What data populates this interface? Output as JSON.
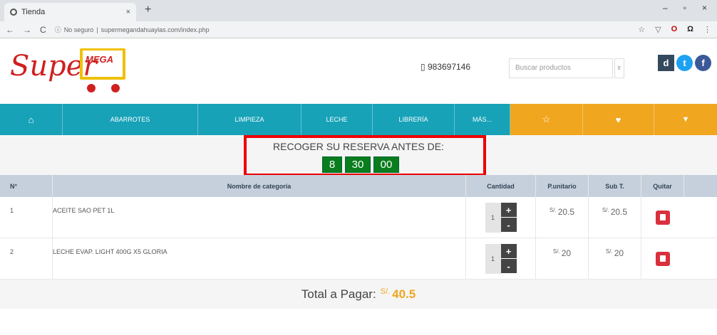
{
  "browser": {
    "tab_title": "Tienda",
    "tab_close": "×",
    "new_tab": "+",
    "url_security": "No seguro",
    "url": "supermegandahuaylas.com/index.php",
    "window_controls": [
      "–",
      "▫",
      "×"
    ]
  },
  "header": {
    "logo_super": "Super",
    "logo_mega": "MEGA",
    "phone": "983697146",
    "search_placeholder": "Buscar productos",
    "search_button": "ir",
    "social": [
      "d",
      "t",
      "f"
    ],
    "colors": {
      "nav": "#17a2b8",
      "accent": "#f0a61f",
      "logo_red": "#d02020"
    }
  },
  "nav": {
    "home_icon": "home-icon",
    "items": [
      "ABARROTES",
      "LIMPIEZA",
      "LECHE",
      "LIBRERÍA",
      "MÁS..."
    ],
    "right_icons": [
      "star-icon",
      "shirt-icon",
      "cart-icon"
    ]
  },
  "countdown": {
    "title": "RECOGER SU RESERVA ANTES DE:",
    "hours": "8",
    "minutes": "30",
    "seconds": "00"
  },
  "table": {
    "headers": [
      "N°",
      "Nombre de categoría",
      "Cantidad",
      "P.unitario",
      "Sub T.",
      "Quitar"
    ],
    "currency": "S/.",
    "rows": [
      {
        "n": "1",
        "name": "ACEITE SAO PET 1L",
        "qty": "1",
        "unit": "20.5",
        "sub": "20.5"
      },
      {
        "n": "2",
        "name": "LECHE EVAP. LIGHT 400G X5 GLORIA",
        "qty": "1",
        "unit": "20",
        "sub": "20"
      }
    ],
    "plus": "+",
    "minus": "-"
  },
  "total": {
    "label": "Total a Pagar:",
    "currency": "S/.",
    "amount": "40.5"
  }
}
